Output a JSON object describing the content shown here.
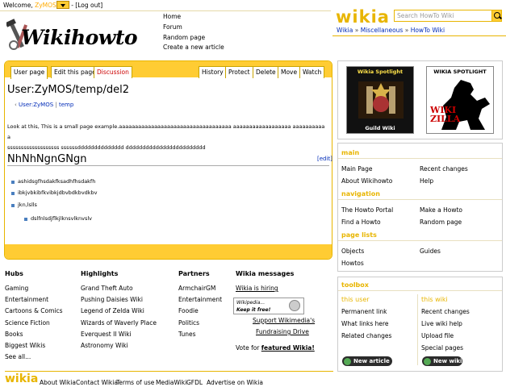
{
  "topbar": {
    "welcome": "Welcome,",
    "username": "ZyMOS",
    "welcome_end": "ZyMOS!",
    "logout": "[Log out]"
  },
  "logo": {
    "text": "Wikihowto"
  },
  "topnav": [
    "Home",
    "Forum",
    "Random page",
    "Create a new article"
  ],
  "wikia": {
    "logo": "wikia",
    "search_placeholder": "Search HowTo Wiki"
  },
  "breadcrumb": [
    "Wikia",
    "Miscellaneous",
    "HowTo Wiki"
  ],
  "tabs": {
    "left": [
      "User page",
      "Edit this page",
      "Discussion"
    ],
    "right": [
      "History",
      "Protect",
      "Delete",
      "Move",
      "Watch"
    ]
  },
  "article": {
    "title": "User:ZyMOS/temp/del2",
    "subpages": [
      "User:ZyMOS",
      "temp"
    ],
    "p1_line1": "Look at this, This is a small page example.aaaaaaaaaaaaaaaaaaaaaaaaaaaaaaaaaaa aaaaaaaaaaaaaaaaaa aaaaaaaaaaa",
    "p1_line2": "sssssssssssssssssss ssssssdddddddddddddd dddddddddddddddddddddddd",
    "heading": "NhNhNgnGNgn",
    "edit": "[edit]",
    "list": [
      "ashidsgfhsdakfksadhfhsdakfh",
      "ibkjvbkibfkvibkjdbvbdkbvdkbv",
      "jkn,lslls"
    ],
    "sublist": [
      "dslfnlsdjflkjlknsvlknvslv"
    ]
  },
  "footer": {
    "hubs": {
      "title": "Hubs",
      "items": [
        "Gaming",
        "Entertainment",
        "Cartoons & Comics",
        "Science Fiction",
        "Books",
        "Biggest Wikis",
        "See all..."
      ]
    },
    "highlights": {
      "title": "Highlights",
      "items": [
        "Grand Theft Auto",
        "Pushing Daisies Wiki",
        "Legend of Zelda Wiki",
        "Wizards of Waverly Place",
        "Everquest II Wiki",
        "Astronomy Wiki"
      ]
    },
    "partners": {
      "title": "Partners",
      "items": [
        "ArmchairGM",
        "Entertainment",
        "Foodie",
        "Politics",
        "Tunes"
      ]
    },
    "messages": {
      "title": "Wikia messages",
      "hiring": "Wikia is hiring",
      "img1": "Wikipedia...",
      "img2": "Keep it free!",
      "support": "Support Wikimedia's",
      "fundraising": "Fundraising Drive",
      "vote_pre": "Vote for",
      "vote_link": "featured Wikia!"
    }
  },
  "sidebar": {
    "spotlight_title": "Wikia Spotlight",
    "spotlight1_sub": "Guild Wiki",
    "spotlight2_title": "WIKIA SPOTLIGHT",
    "spotlight2_sub": "WIKIZILLA",
    "main": {
      "title": "main",
      "items": [
        "Main Page",
        "Recent changes",
        "About Wikihowto",
        "Help"
      ]
    },
    "navigation": {
      "title": "navigation",
      "items": [
        "The Howto Portal",
        "Make a Howto",
        "Find a Howto",
        "Random page"
      ]
    },
    "page_lists": {
      "title": "page lists",
      "items": [
        "Objects",
        "Guides",
        "Howtos"
      ]
    },
    "toolbox": {
      "title": "toolbox",
      "user_title": "this user",
      "wiki_title": "this wiki",
      "user_items": [
        "Permanent link",
        "What links here",
        "Related changes"
      ],
      "wiki_items": [
        "Recent changes",
        "Live wiki help",
        "Upload file",
        "Special pages"
      ],
      "new_article": "New article",
      "new_wiki": "New wiki"
    }
  },
  "bottom": {
    "logo": "wikia",
    "links": [
      "About Wikia",
      "Contact Wikia",
      "Terms of use",
      "MediaWiki",
      "GFDL",
      "Advertise on Wikia"
    ]
  },
  "colors": {
    "accent": "#ffcc33",
    "link": "#002bb8",
    "wikia_gold": "#e8b500"
  }
}
